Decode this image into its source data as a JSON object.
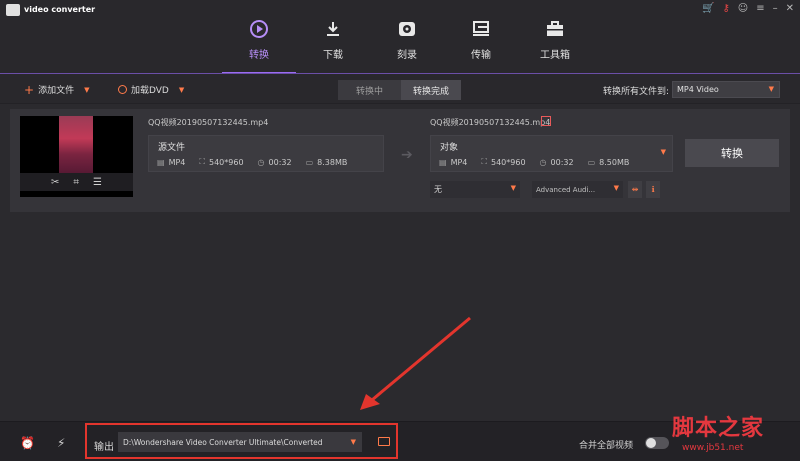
{
  "app": {
    "title": "video converter"
  },
  "window_icons": [
    "cart-icon",
    "key-icon",
    "user-icon",
    "menu-icon",
    "minimize-icon",
    "close-icon"
  ],
  "nav": {
    "tabs": [
      {
        "label": "转换",
        "icon": "convert-icon",
        "active": true
      },
      {
        "label": "下载",
        "icon": "download-icon",
        "active": false
      },
      {
        "label": "刻录",
        "icon": "burn-icon",
        "active": false
      },
      {
        "label": "传输",
        "icon": "transfer-icon",
        "active": false
      },
      {
        "label": "工具箱",
        "icon": "toolbox-icon",
        "active": false
      }
    ]
  },
  "toolbar": {
    "add_files": "添加文件",
    "load_dvd": "加载DVD",
    "tab_converting": "转换中",
    "tab_converted": "转换完成",
    "convert_all_to": "转换所有文件到:",
    "format": "MP4 Video"
  },
  "file": {
    "source_name": "QQ视频20190507132445.mp4",
    "source": {
      "label": "源文件",
      "format": "MP4",
      "resolution": "540*960",
      "duration": "00:32",
      "size": "8.38MB"
    },
    "target_name": "QQ视频20190507132445.mp4",
    "target": {
      "label": "对象",
      "format": "MP4",
      "resolution": "540*960",
      "duration": "00:32",
      "size": "8.50MB"
    },
    "convert_button": "转换",
    "subtitle": "无",
    "audio": "Advanced Audi..."
  },
  "bottom": {
    "output_label": "输出",
    "output_path": "D:\\Wondershare Video Converter Ultimate\\Converted",
    "merge_label": "合并全部视频"
  },
  "watermark": {
    "text": "脚本之家",
    "url": "www.jb51.net"
  },
  "colors": {
    "accent": "#9b6cf2",
    "orange": "#ff7a4a",
    "highlight": "#e3352d"
  }
}
